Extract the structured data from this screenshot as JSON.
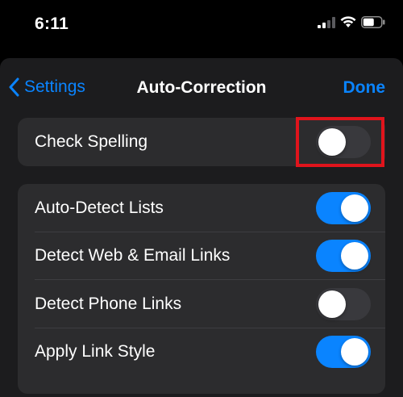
{
  "status_bar": {
    "time": "6:11",
    "icons": [
      "cellular-signal-icon",
      "wifi-icon",
      "battery-icon"
    ]
  },
  "nav": {
    "back_label": "Settings",
    "title": "Auto-Correction",
    "done_label": "Done"
  },
  "settings": {
    "check_spelling": {
      "label": "Check Spelling",
      "enabled": false,
      "highlighted": true
    },
    "items": [
      {
        "label": "Auto-Detect Lists",
        "enabled": true
      },
      {
        "label": "Detect Web & Email Links",
        "enabled": true
      },
      {
        "label": "Detect Phone Links",
        "enabled": false
      },
      {
        "label": "Apply Link Style",
        "enabled": true
      }
    ]
  },
  "colors": {
    "accent": "#0a84ff",
    "toggle_off": "#39393d",
    "highlight": "#e0141c",
    "group_bg": "#2c2c2e",
    "sheet_bg": "#1c1c1e"
  }
}
